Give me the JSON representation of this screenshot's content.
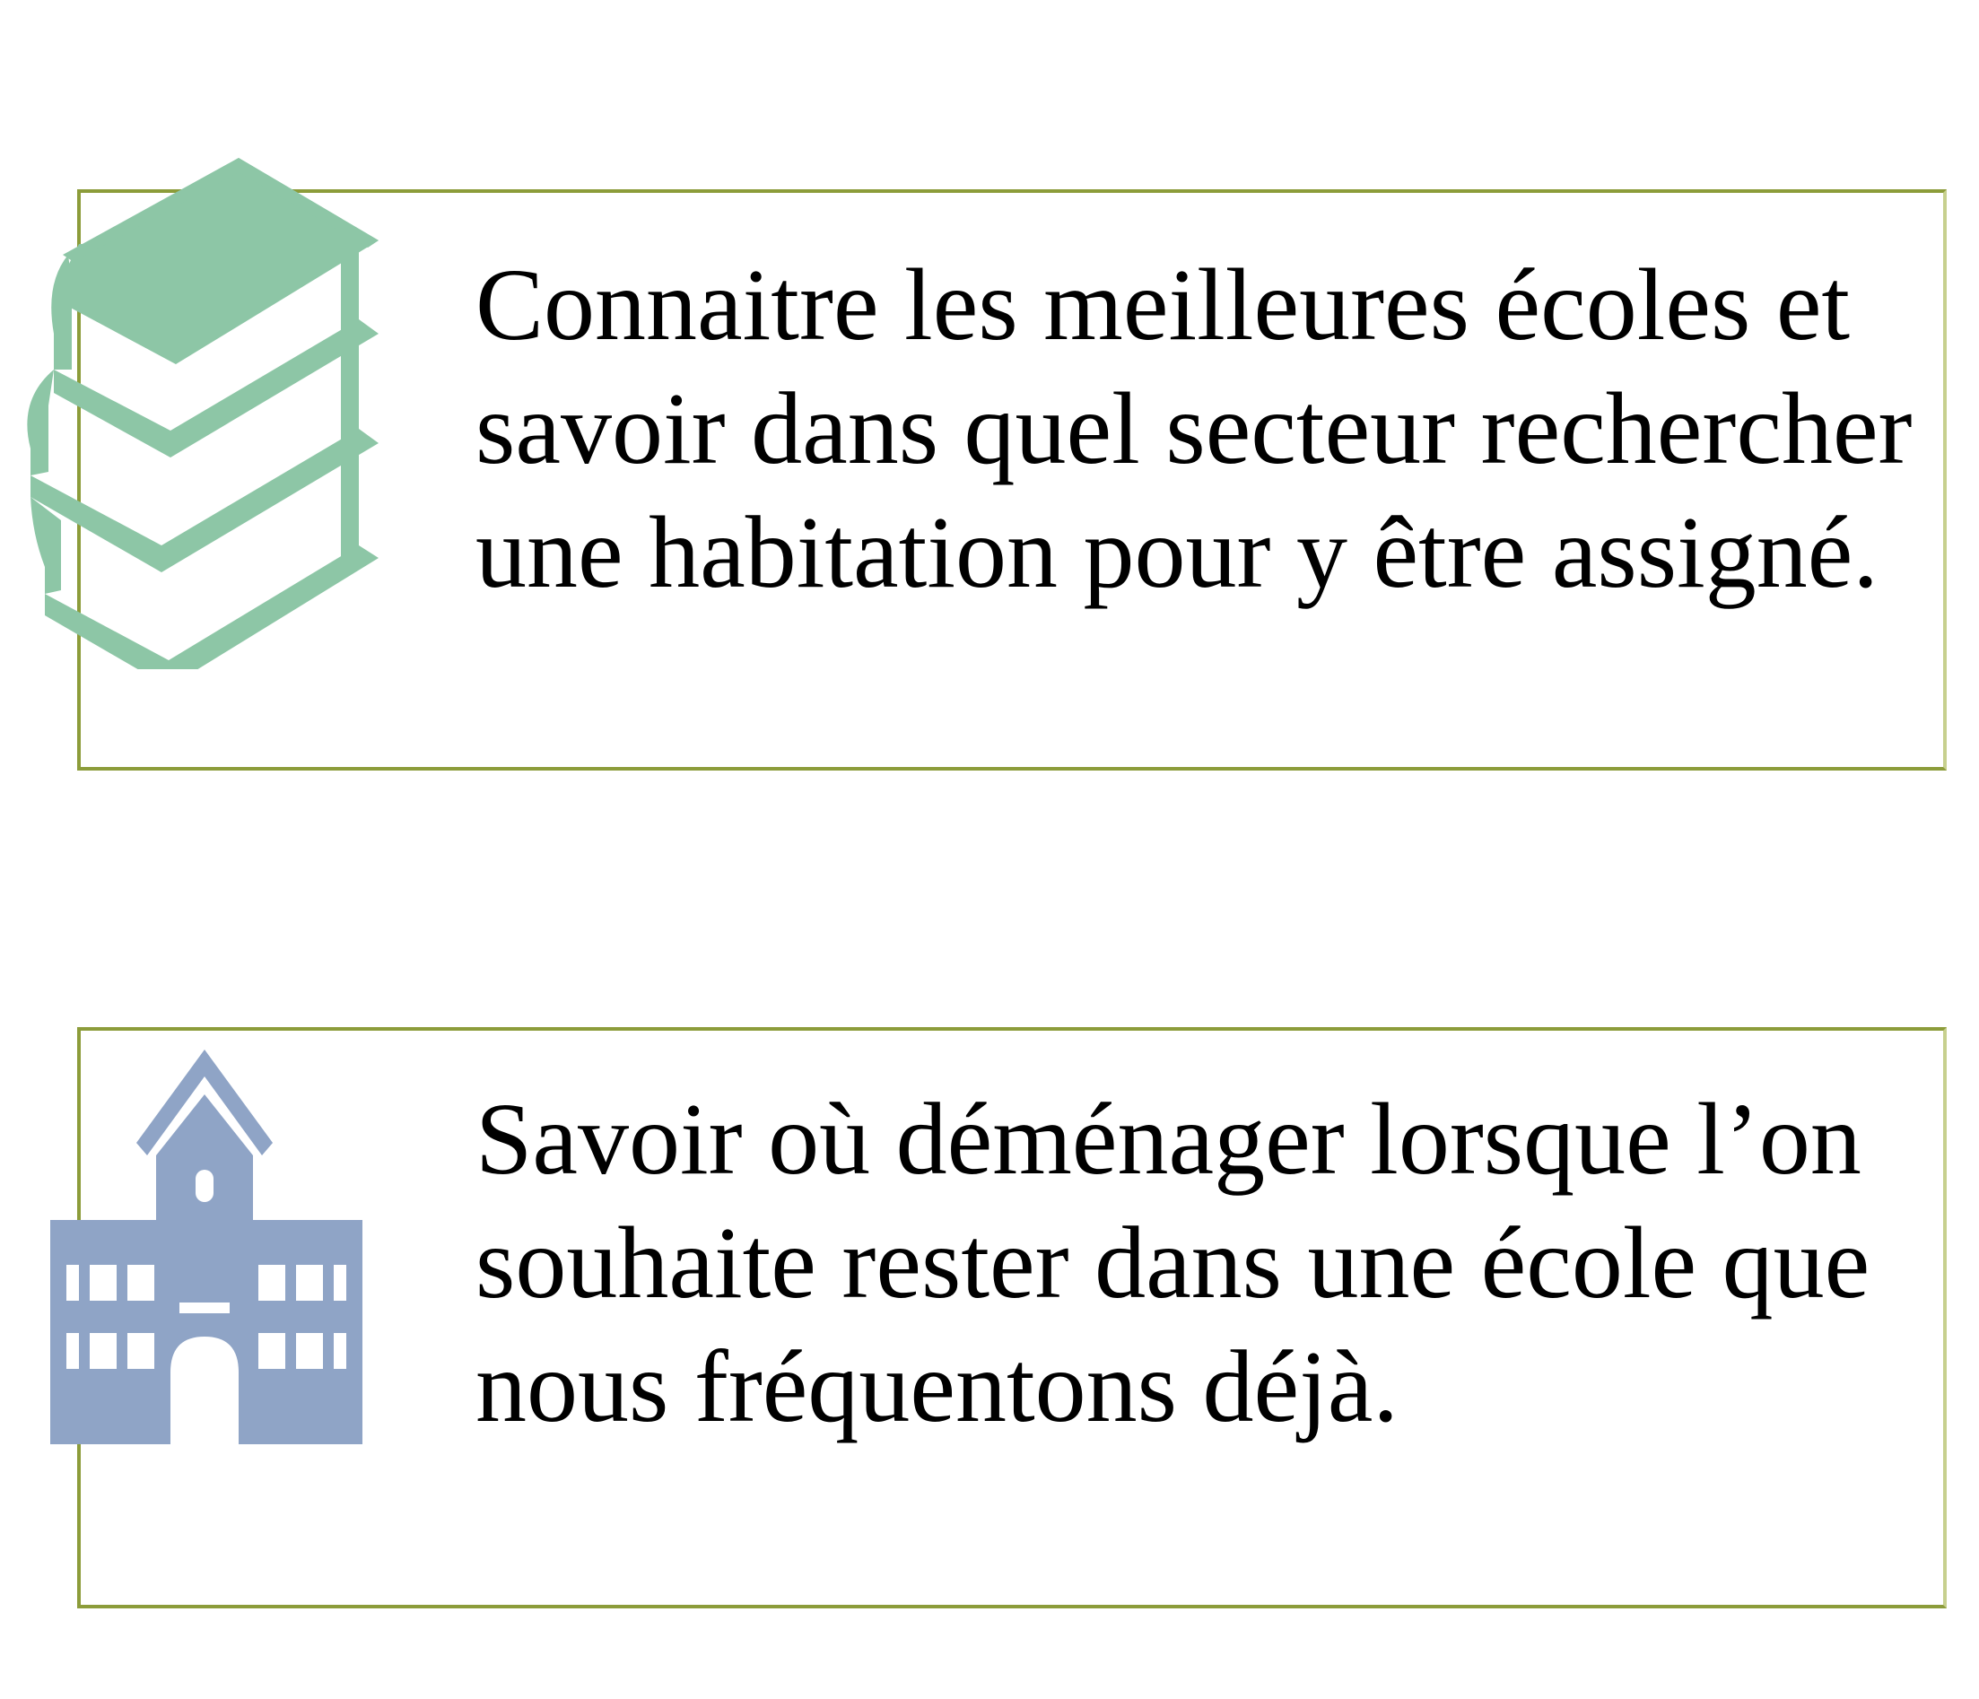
{
  "items": [
    {
      "icon": "books-stack-icon",
      "icon_color": "#8dc6a6",
      "text": "Connaitre les meilleures écoles et savoir dans quel secteur rechercher une habitation pour y être assigné."
    },
    {
      "icon": "school-building-icon",
      "icon_color": "#8fa4c6",
      "text": "Savoir où déménager lorsque l’on souhaite rester dans une école que nous fréquentons déjà."
    }
  ],
  "colors": {
    "border": "#8c9c3a",
    "text": "#000000",
    "background": "#ffffff"
  }
}
